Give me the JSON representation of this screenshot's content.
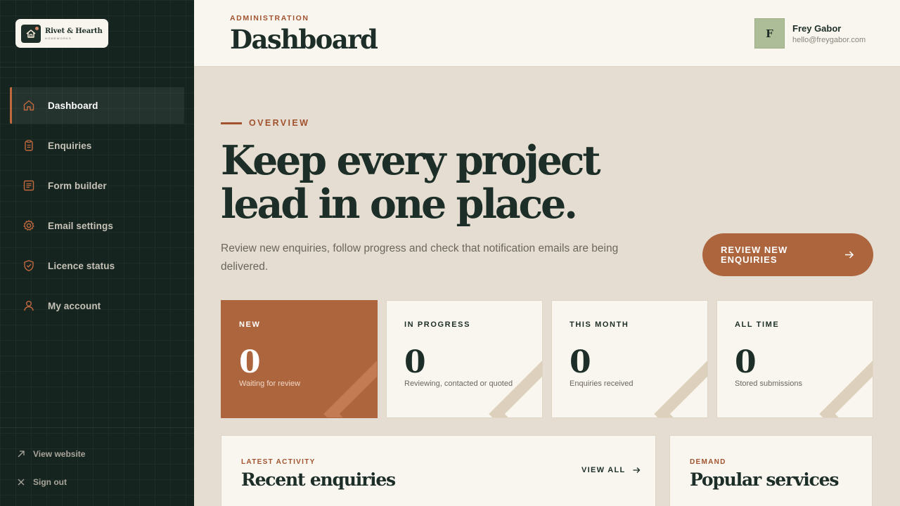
{
  "brand": {
    "name": "Rivet & Hearth",
    "subtitle": "HOMEWORKS"
  },
  "sidebar": {
    "items": [
      {
        "label": "Dashboard",
        "icon": "home-icon",
        "active": true
      },
      {
        "label": "Enquiries",
        "icon": "clipboard-icon"
      },
      {
        "label": "Form builder",
        "icon": "form-icon"
      },
      {
        "label": "Email settings",
        "icon": "gear-icon"
      },
      {
        "label": "Licence status",
        "icon": "shield-check-icon"
      },
      {
        "label": "My account",
        "icon": "user-icon"
      }
    ],
    "footer": {
      "view_website": "View website",
      "sign_out": "Sign out"
    }
  },
  "header": {
    "eyebrow": "ADMINISTRATION",
    "title": "Dashboard",
    "user": {
      "initial": "F",
      "name": "Frey Gabor",
      "email": "hello@freygabor.com"
    }
  },
  "hero": {
    "kicker": "OVERVIEW",
    "title_line1": "Keep every project",
    "title_line2": "lead in one place.",
    "description": "Review new enquiries, follow progress and check that notification emails are being delivered.",
    "cta_label": "REVIEW NEW ENQUIRIES"
  },
  "stats": [
    {
      "label": "NEW",
      "value": "0",
      "desc": "Waiting for review"
    },
    {
      "label": "IN PROGRESS",
      "value": "0",
      "desc": "Reviewing, contacted or quoted"
    },
    {
      "label": "THIS MONTH",
      "value": "0",
      "desc": "Enquiries received"
    },
    {
      "label": "ALL TIME",
      "value": "0",
      "desc": "Stored submissions"
    }
  ],
  "panels": {
    "recent": {
      "eyebrow": "LATEST ACTIVITY",
      "title": "Recent enquiries",
      "view_all": "VIEW ALL"
    },
    "popular": {
      "eyebrow": "DEMAND",
      "title": "Popular services"
    }
  },
  "colors": {
    "sidebar_bg": "#15241f",
    "accent": "#ad653e",
    "accent_text": "#a0532e",
    "page_bg": "#e5ddd1",
    "card_bg": "#f9f6ef",
    "ink": "#1c2e27"
  }
}
